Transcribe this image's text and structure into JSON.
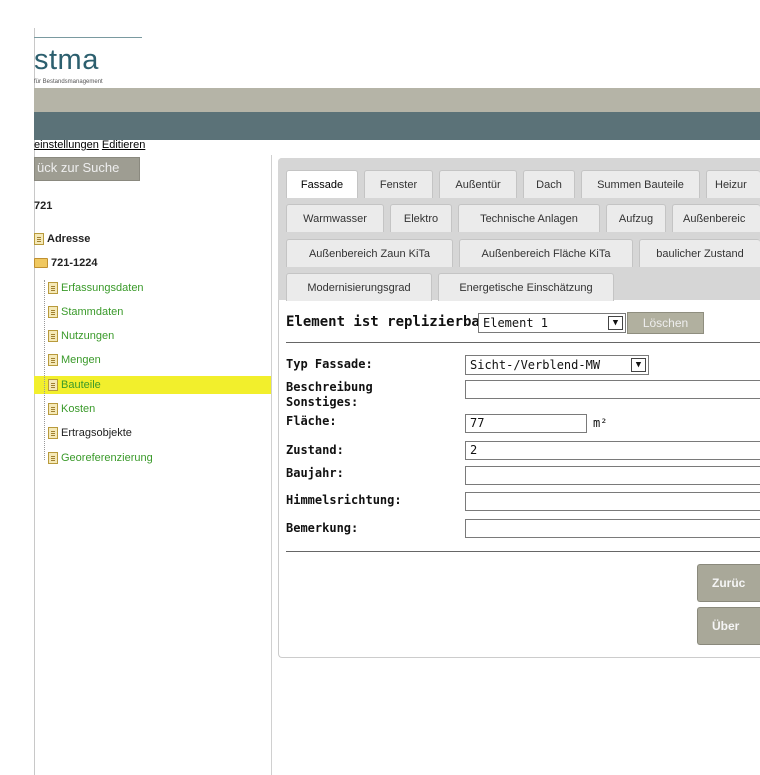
{
  "logo": {
    "text": "stma",
    "subtitle": "für Bestandsmanagement"
  },
  "top_links": {
    "einstellungen": "einstellungen",
    "editieren": "Editieren"
  },
  "back_button": "ück zur Suche",
  "tree": {
    "root": "721",
    "items": [
      {
        "label": "Adresse",
        "style": "bold",
        "icon": "document-icon"
      },
      {
        "label": "721-1224",
        "style": "bold",
        "icon": "folder-open-icon"
      },
      {
        "label": "Erfassungsdaten",
        "style": "green",
        "icon": "document-icon"
      },
      {
        "label": "Stammdaten",
        "style": "green",
        "icon": "document-icon"
      },
      {
        "label": "Nutzungen",
        "style": "green",
        "icon": "document-icon"
      },
      {
        "label": "Mengen",
        "style": "green",
        "icon": "document-icon"
      },
      {
        "label": "Bauteile",
        "style": "green-selected",
        "icon": "document-icon"
      },
      {
        "label": "Kosten",
        "style": "green",
        "icon": "document-icon"
      },
      {
        "label": "Ertragsobjekte",
        "style": "black",
        "icon": "document-icon"
      },
      {
        "label": "Georeferenzierung",
        "style": "green",
        "icon": "document-icon"
      }
    ]
  },
  "tabs": {
    "row1": [
      "Fassade",
      "Fenster",
      "Außentür",
      "Dach",
      "Summen Bauteile",
      "Heizur"
    ],
    "row2": [
      "Warmwasser",
      "Elektro",
      "Technische Anlagen",
      "Aufzug",
      "Außenbereic"
    ],
    "row3": [
      "Außenbereich Zaun KiTa",
      "Außenbereich Fläche KiTa",
      "baulicher Zustand"
    ],
    "row4": [
      "Modernisierungsgrad",
      "Energetische Einschätzung"
    ],
    "active": "Fassade"
  },
  "form": {
    "element_label": "Element ist replizierbar:",
    "element_value": "Element 1",
    "delete_button": "Löschen",
    "typ_label": "Typ Fassade:",
    "typ_value": "Sicht-/Verblend-MW",
    "beschreibung_label_1": "Beschreibung",
    "beschreibung_label_2": "Sonstiges:",
    "beschreibung_value": "",
    "flaeche_label": "Fläche:",
    "flaeche_value": "77",
    "flaeche_unit": "m²",
    "zustand_label": "Zustand:",
    "zustand_value": "2",
    "baujahr_label": "Baujahr:",
    "baujahr_value": "",
    "himmel_label": "Himmelsrichtung:",
    "himmel_value": "",
    "bemerkung_label": "Bemerkung:",
    "bemerkung_value": ""
  },
  "actions": {
    "back": "Zurüc",
    "submit": "Über"
  },
  "colors": {
    "accent_teal": "#2c5f6e",
    "band_gray": "#b5b4a7",
    "band_dark": "#5b7278",
    "highlight": "#f2ef2c",
    "tree_green": "#3a9a2a"
  }
}
